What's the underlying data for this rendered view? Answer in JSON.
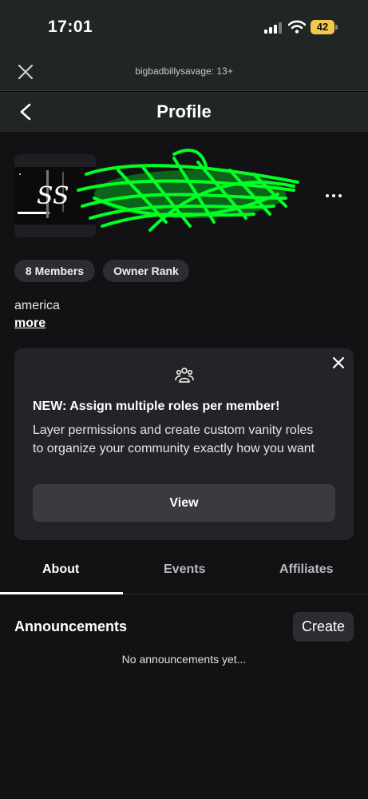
{
  "status_bar": {
    "time": "17:01",
    "battery": "42"
  },
  "webview": {
    "site_label": "bigbadbillysavage: 13+"
  },
  "nav": {
    "title": "Profile"
  },
  "group": {
    "chips": [
      {
        "label": "8 Members"
      },
      {
        "label": "Owner Rank"
      }
    ],
    "description": "america",
    "more_link": "more"
  },
  "promo": {
    "title": "NEW: Assign multiple roles per member!",
    "body": "Layer permissions and create custom vanity roles to organize your community exactly how you want",
    "button": "View"
  },
  "tabs": [
    {
      "label": "About"
    },
    {
      "label": "Events"
    },
    {
      "label": "Affiliates"
    }
  ],
  "announcements": {
    "title": "Announcements",
    "create": "Create",
    "empty": "No announcements yet..."
  },
  "colors": {
    "background": "#121215",
    "header": "#222526",
    "card": "#232427",
    "chip": "#2b2d31",
    "scribble": "#00ff22"
  }
}
